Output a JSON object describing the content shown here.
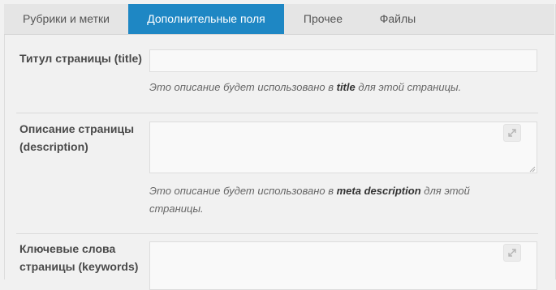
{
  "tabs": [
    {
      "label": "Рубрики и метки",
      "active": false
    },
    {
      "label": "Дополнительные поля",
      "active": true
    },
    {
      "label": "Прочее",
      "active": false
    },
    {
      "label": "Файлы",
      "active": false
    }
  ],
  "fields": {
    "title": {
      "label": "Титул страницы (title)",
      "value": "",
      "desc_before": "Это описание будет использовано в ",
      "desc_bold": "title",
      "desc_after": " для этой страницы."
    },
    "description": {
      "label": "Описание страницы (description)",
      "value": "",
      "desc_before": "Это описание будет использовано в ",
      "desc_bold": "meta description",
      "desc_after": " для этой страницы."
    },
    "keywords": {
      "label": "Ключевые слова страницы (keywords)",
      "value": ""
    }
  },
  "colors": {
    "active_tab": "#1e87c4",
    "tab_bar": "#e5e5e5",
    "background": "#f1f1f1"
  },
  "icons": {
    "expand": "expand-icon",
    "resize": "resize-grip-icon"
  }
}
